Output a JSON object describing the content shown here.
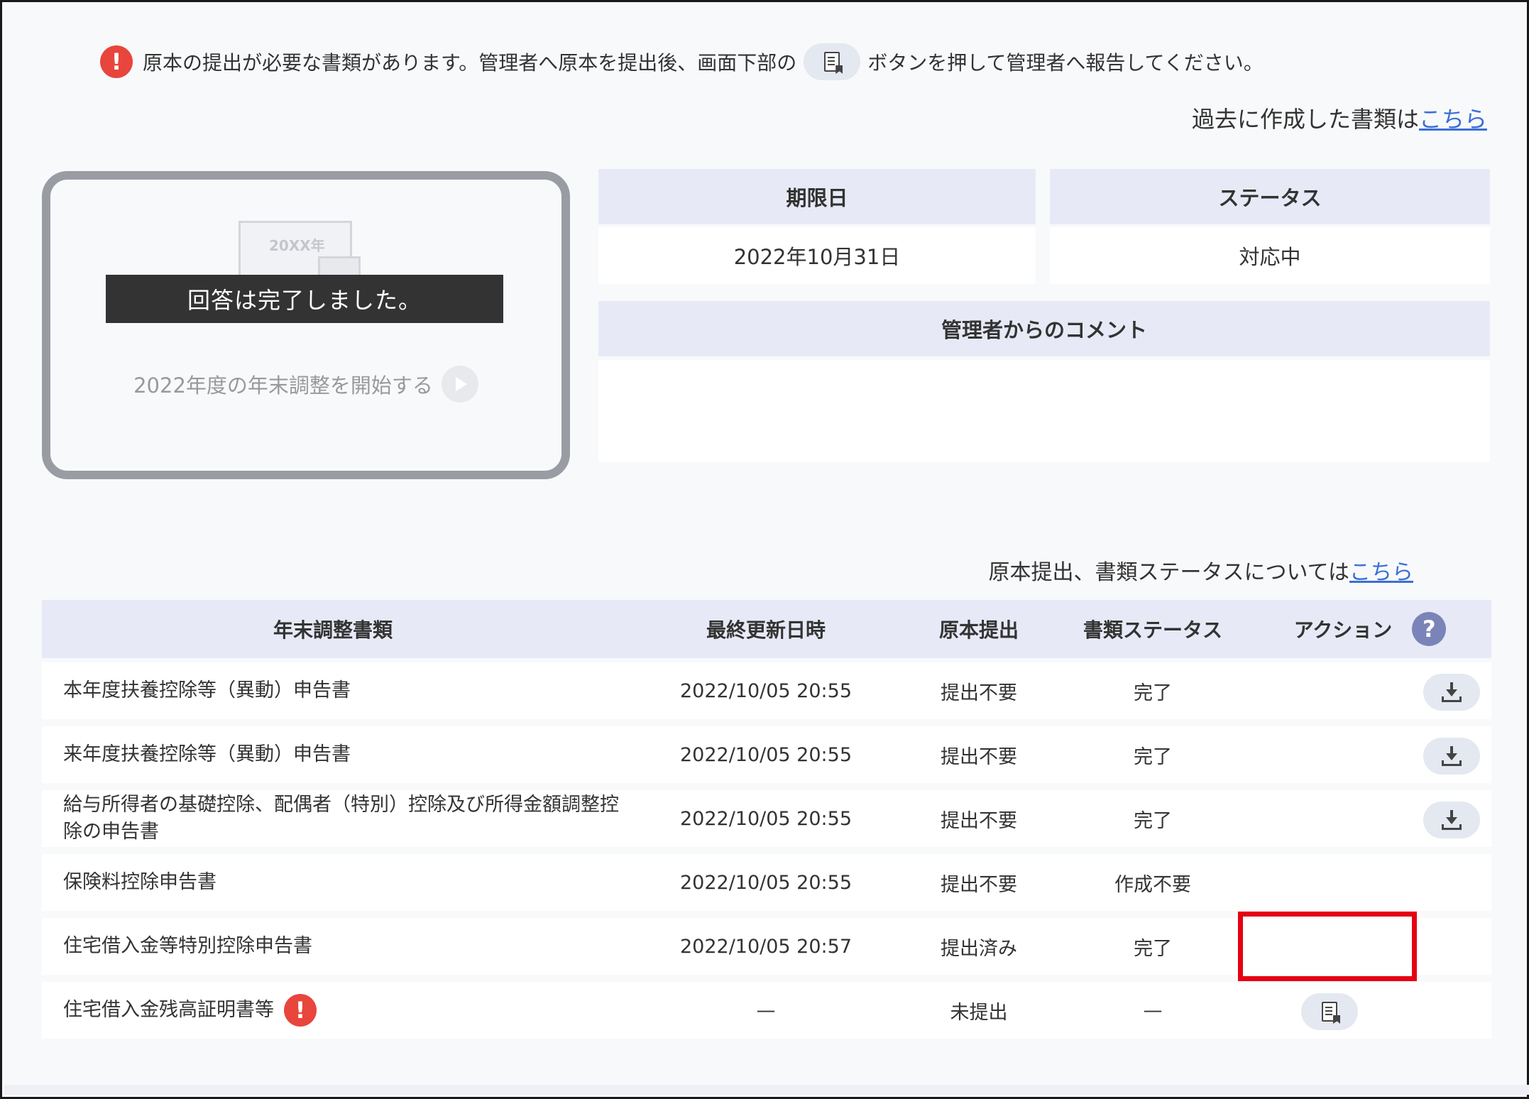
{
  "notice": {
    "text_before": "原本の提出が必要な書類があります。管理者へ原本を提出後、画面下部の",
    "text_after": "ボタンを押して管理者へ報告してください。",
    "alert_symbol": "!"
  },
  "past_docs": {
    "text": "過去に作成した書類は",
    "link": "こちら"
  },
  "card": {
    "illustration_year": "20XX年",
    "banner": "回答は完了しました。",
    "start_link": "2022年度の年末調整を開始する"
  },
  "info": {
    "deadline_label": "期限日",
    "deadline_value": "2022年10月31日",
    "status_label": "ステータス",
    "status_value": "対応中",
    "comment_label": "管理者からのコメント",
    "comment_value": ""
  },
  "status_help": {
    "text": "原本提出、書類ステータスについては",
    "link": "こちら"
  },
  "table": {
    "headers": {
      "doc": "年末調整書類",
      "updated": "最終更新日時",
      "original": "原本提出",
      "status": "書類ステータス",
      "action": "アクション",
      "help": "?"
    },
    "rows": [
      {
        "name": "本年度扶養控除等（異動）申告書",
        "updated": "2022/10/05 20:55",
        "original": "提出不要",
        "status": "完了",
        "action": "download"
      },
      {
        "name": "来年度扶養控除等（異動）申告書",
        "updated": "2022/10/05 20:55",
        "original": "提出不要",
        "status": "完了",
        "action": "download"
      },
      {
        "name": "給与所得者の基礎控除、配偶者（特別）控除及び所得金額調整控除の申告書",
        "updated": "2022/10/05 20:55",
        "original": "提出不要",
        "status": "完了",
        "action": "download"
      },
      {
        "name": "保険料控除申告書",
        "updated": "2022/10/05 20:55",
        "original": "提出不要",
        "status": "作成不要",
        "action": "none"
      },
      {
        "name": "住宅借入金等特別控除申告書",
        "updated": "2022/10/05 20:57",
        "original": "提出済み",
        "status": "完了",
        "action": "none"
      },
      {
        "name": "住宅借入金残高証明書等",
        "updated": "—",
        "original": "未提出",
        "status": "—",
        "action": "report",
        "alert": "!"
      }
    ]
  },
  "colors": {
    "header_bg": "#e7eaf6",
    "alert_red": "#e8453c",
    "link_blue": "#3b6fd6",
    "highlight_red": "#e60012",
    "banner_bg": "#333333"
  }
}
